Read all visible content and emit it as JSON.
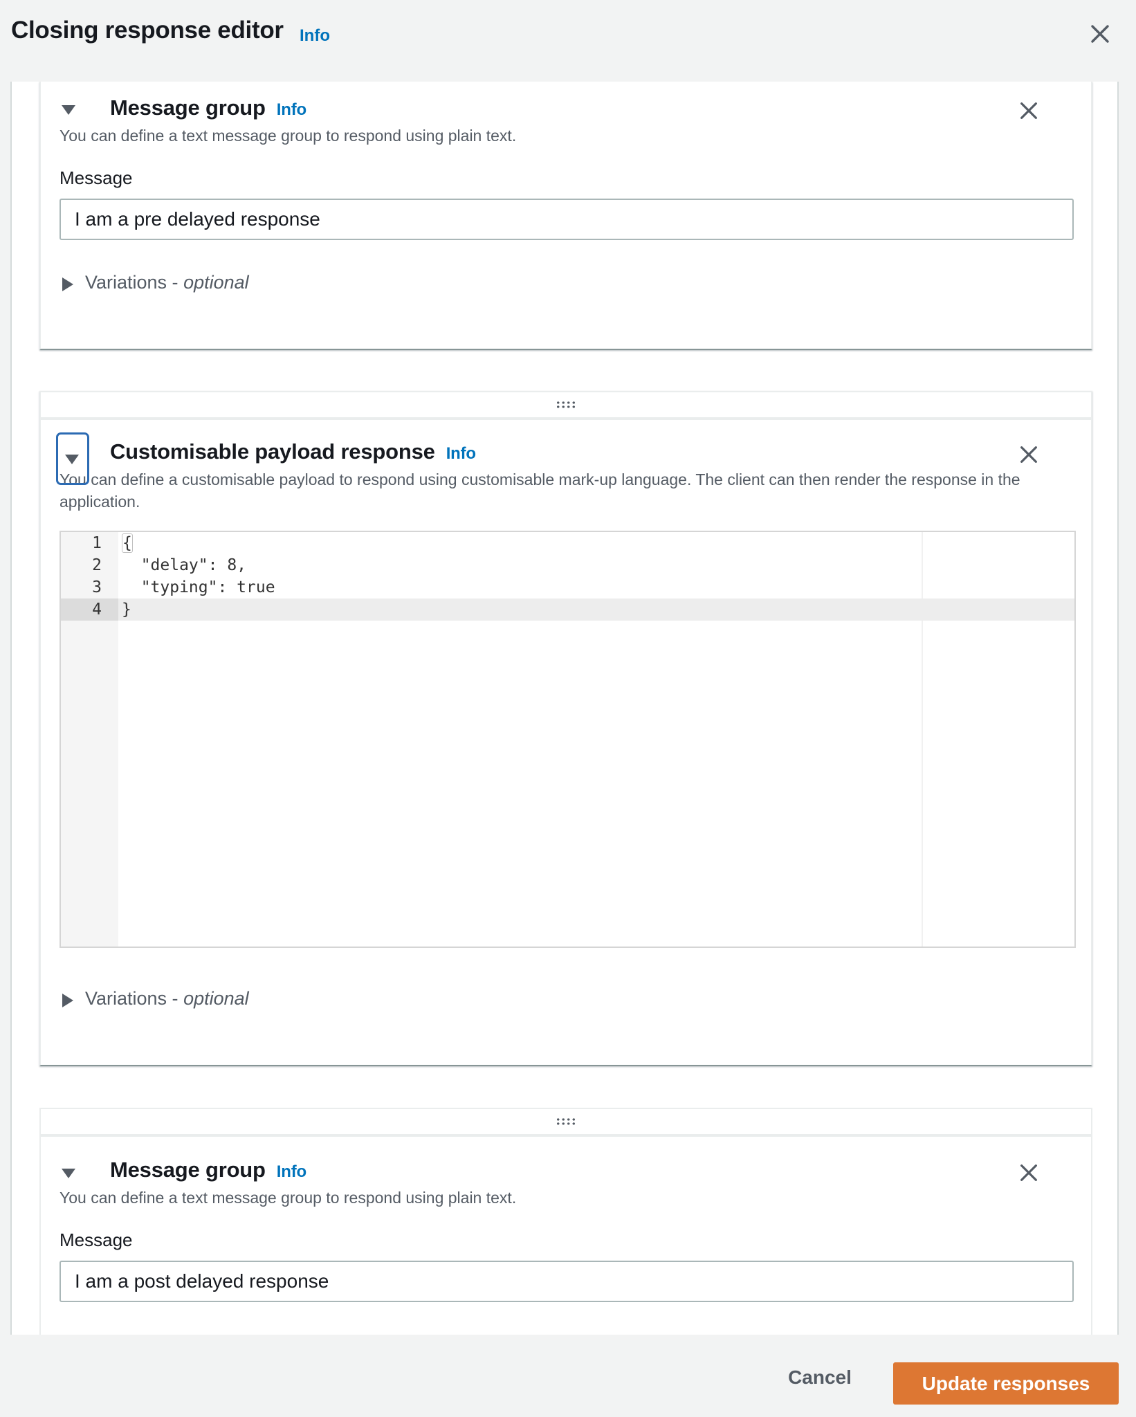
{
  "header": {
    "title": "Closing response editor",
    "info_label": "Info",
    "close_icon": "close-icon"
  },
  "cards": [
    {
      "type": "message-group",
      "title": "Message group",
      "info_label": "Info",
      "description": "You can define a text message group to respond using plain text.",
      "field_label": "Message",
      "message_value": "I am a pre delayed response",
      "variations_label": "Variations - ",
      "variations_optional": "optional",
      "expanded": true
    },
    {
      "type": "custom-payload",
      "drag_handle_icon": "drag-handle-icon",
      "title": "Customisable payload response",
      "info_label": "Info",
      "description": "You can define a customisable payload to respond using customisable mark-up language. The client can then render the response in the application.",
      "code_lines": [
        {
          "number": "1",
          "text": "{"
        },
        {
          "number": "2",
          "text": "  \"delay\": 8,"
        },
        {
          "number": "3",
          "text": "  \"typing\": true"
        },
        {
          "number": "4",
          "text": "}"
        }
      ],
      "active_line": 4,
      "variations_label": "Variations - ",
      "variations_optional": "optional",
      "expanded": true,
      "focused_toggle": true
    },
    {
      "type": "message-group",
      "drag_handle_icon": "drag-handle-icon",
      "title": "Message group",
      "info_label": "Info",
      "description": "You can define a text message group to respond using plain text.",
      "field_label": "Message",
      "message_value": "I am a post delayed response",
      "expanded": true
    }
  ],
  "footer": {
    "cancel_label": "Cancel",
    "primary_label": "Update responses",
    "primary_color": "#dd7733"
  },
  "colors": {
    "link": "#0073bb",
    "focus_ring": "#2c6bb3",
    "background": "#f2f3f3"
  }
}
